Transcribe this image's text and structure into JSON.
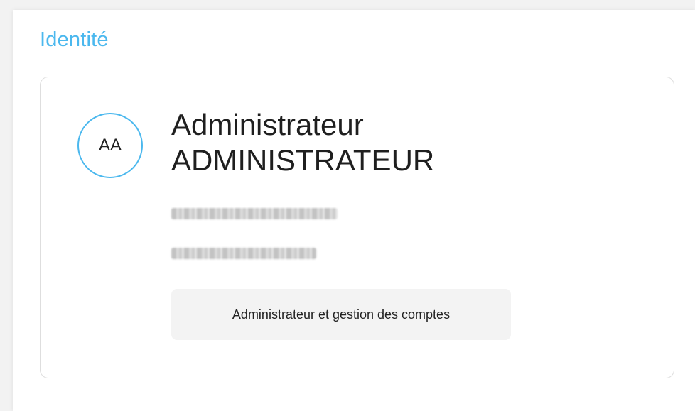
{
  "section": {
    "title": "Identité"
  },
  "user": {
    "initials": "AA",
    "first_name": "Administrateur",
    "last_name": "ADMINISTRATEUR",
    "email": "",
    "phone": "",
    "role": "Administrateur et gestion des comptes"
  },
  "colors": {
    "accent": "#4bb8ee",
    "chip_background": "#f3f3f3",
    "card_border": "#dedede"
  }
}
